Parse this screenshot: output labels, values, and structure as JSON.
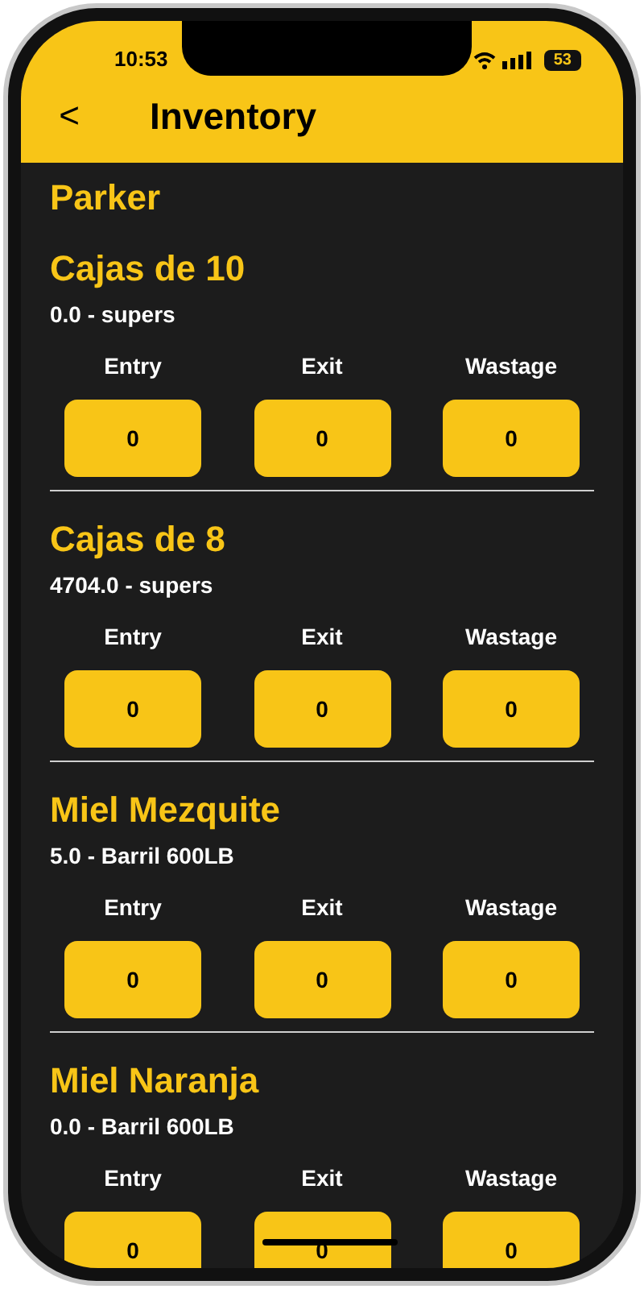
{
  "status_bar": {
    "time": "10:53",
    "battery": "53"
  },
  "header": {
    "back": "<",
    "title": "Inventory"
  },
  "group": "Parker",
  "products": [
    {
      "name": "Cajas de 10",
      "stock": "0.0 - supers",
      "fields": [
        {
          "label": "Entry",
          "value": "0"
        },
        {
          "label": "Exit",
          "value": "0"
        },
        {
          "label": "Wastage",
          "value": "0"
        }
      ]
    },
    {
      "name": "Cajas de 8",
      "stock": "4704.0 - supers",
      "fields": [
        {
          "label": "Entry",
          "value": "0"
        },
        {
          "label": "Exit",
          "value": "0"
        },
        {
          "label": "Wastage",
          "value": "0"
        }
      ]
    },
    {
      "name": "Miel Mezquite",
      "stock": "5.0 - Barril 600LB",
      "fields": [
        {
          "label": "Entry",
          "value": "0"
        },
        {
          "label": "Exit",
          "value": "0"
        },
        {
          "label": "Wastage",
          "value": "0"
        }
      ]
    },
    {
      "name": "Miel Naranja",
      "stock": "0.0 - Barril 600LB",
      "fields": [
        {
          "label": "Entry",
          "value": "0"
        },
        {
          "label": "Exit",
          "value": "0"
        },
        {
          "label": "Wastage",
          "value": "0"
        }
      ]
    }
  ]
}
